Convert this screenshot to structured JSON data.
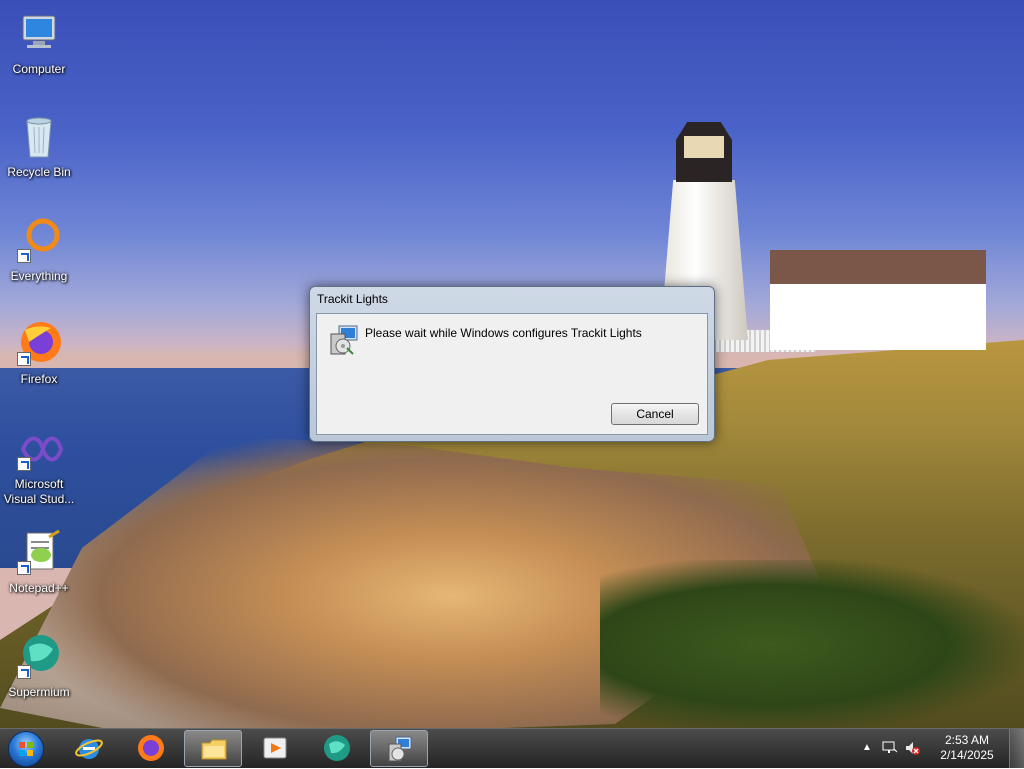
{
  "desktop": {
    "icons": [
      {
        "label": "Computer",
        "icon": "computer-icon"
      },
      {
        "label": "Recycle Bin",
        "icon": "recycle-bin-icon"
      },
      {
        "label": "Everything",
        "icon": "everything-icon"
      },
      {
        "label": "Firefox",
        "icon": "firefox-icon"
      },
      {
        "label": "Microsoft Visual Stud...",
        "icon": "visual-studio-icon"
      },
      {
        "label": "Notepad++",
        "icon": "notepadpp-icon"
      },
      {
        "label": "Supermium",
        "icon": "supermium-icon"
      }
    ]
  },
  "dialog": {
    "title": "Trackit Lights",
    "message": "Please wait while Windows configures Trackit Lights",
    "cancel_label": "Cancel",
    "icon": "installer-icon"
  },
  "taskbar": {
    "start_icon": "windows-start-icon",
    "pinned": [
      {
        "icon": "internet-explorer-icon",
        "active": false
      },
      {
        "icon": "firefox-icon",
        "active": false
      },
      {
        "icon": "file-explorer-icon",
        "active": true
      },
      {
        "icon": "media-player-icon",
        "active": false
      },
      {
        "icon": "supermium-icon",
        "active": false
      },
      {
        "icon": "installer-icon",
        "active": true
      }
    ],
    "tray": {
      "time": "2:53 AM",
      "date": "2/14/2025"
    }
  },
  "colors": {
    "taskbar_bg": "#1e1e1e",
    "dialog_frame": "#bfcbdb",
    "dialog_client": "#f0f0f0"
  }
}
